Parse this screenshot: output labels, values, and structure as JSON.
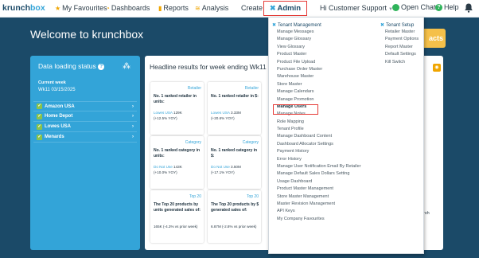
{
  "app": {
    "logo_main": "krunch",
    "logo_accent": "box"
  },
  "nav": {
    "favourites": "My Favourites",
    "dashboards": "Dashboards",
    "reports": "Reports",
    "analysis": "Analysis",
    "create": "Create",
    "admin": "Admin",
    "greeting": "Hi Customer Support",
    "open_chat": "Open Chat",
    "help": "Help"
  },
  "page": {
    "welcome": "Welcome to krunchbox",
    "shortcut_button": "acts"
  },
  "data_loading": {
    "title": "Data loading status",
    "current_week_label": "Current week",
    "current_week_value": "Wk11 03/15/2025",
    "retailers": [
      "Amazon USA",
      "Home Depot",
      "Lowes USA",
      "Menards"
    ]
  },
  "headline": {
    "title": "Headline results for week ending Wk11 0",
    "cards": [
      {
        "category": "Retailer",
        "title": "No. 1 ranked retailer in units:",
        "link": "Lowes USA",
        "value": "129K",
        "change": "(+12.5% YOY)"
      },
      {
        "category": "Retailer",
        "title": "No. 1 ranked retailer in $:",
        "link": "Lowes USA",
        "value": "3.33M",
        "change": "(+20.6% YOY)"
      },
      {
        "category": "Category",
        "title": "No. 1 ranked category in units:",
        "link": "Do Not Use",
        "value": "143K",
        "change": "(+10.0% YOY)"
      },
      {
        "category": "Category",
        "title": "No. 1 ranked category in $:",
        "link": "Do Not Use",
        "value": "3.50M",
        "change": "(+17.1% YOY)"
      },
      {
        "category": "Top 20",
        "title": "The Top 20 products by units generated sales of:",
        "link": "",
        "value": "165K (-4.3% vs prior week)",
        "change": ""
      },
      {
        "category": "Top 20",
        "title": "The Top 20 products by $ generated sales of:",
        "link": "",
        "value": "6.87M (-2.8% vs prior week)",
        "change": ""
      }
    ]
  },
  "side_text": "rsh",
  "admin_menu": {
    "tenant_management": {
      "header": "Tenant Management",
      "items": [
        "Manage Messages",
        "Manage Glossary",
        "View Glossary",
        "Product Master",
        "Product File Upload",
        "Purchase Order Master",
        "Warehouse Master",
        "Store Master",
        "Manage Calendars",
        "Manage Promotion",
        "Manage Users",
        "Manage Notes",
        "Role Mapping",
        "Tenant Profile",
        "Manage Dashboard Content",
        "Dashboard Allocator Settings",
        "Payment History",
        "Error History",
        "Manage User Notification Email By Retailer",
        "Manage Default Sales Dollars Setting",
        "Usage Dashboard",
        "Product Master Management",
        "Store Master Management",
        "Master Revision Management",
        "API Keys",
        "My Company Favourites"
      ]
    },
    "tenant_setup": {
      "header": "Tenant Setup",
      "items": [
        "Retailer Master",
        "Payment Options",
        "Report Master",
        "Default Settings",
        "Kill Switch"
      ]
    },
    "highlighted_item": "Manage Users"
  },
  "colors": {
    "background": "#1b4a68",
    "accent": "#33a4d8",
    "highlight": "#e53935",
    "check": "#8bc34a"
  }
}
